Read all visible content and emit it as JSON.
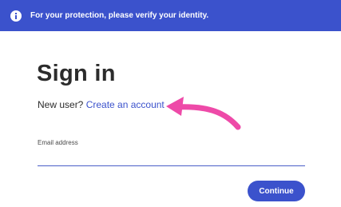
{
  "banner": {
    "icon": "info-icon",
    "text": "For your protection, please verify your identity.",
    "background": "#3b52cc"
  },
  "signin": {
    "title": "Sign in",
    "new_user_prompt": "New user?",
    "create_account_label": "Create an account"
  },
  "email": {
    "label": "Email address",
    "value": ""
  },
  "continue_label": "Continue",
  "annotation": {
    "icon": "pink-arrow-icon",
    "color": "#ee4aa8"
  }
}
